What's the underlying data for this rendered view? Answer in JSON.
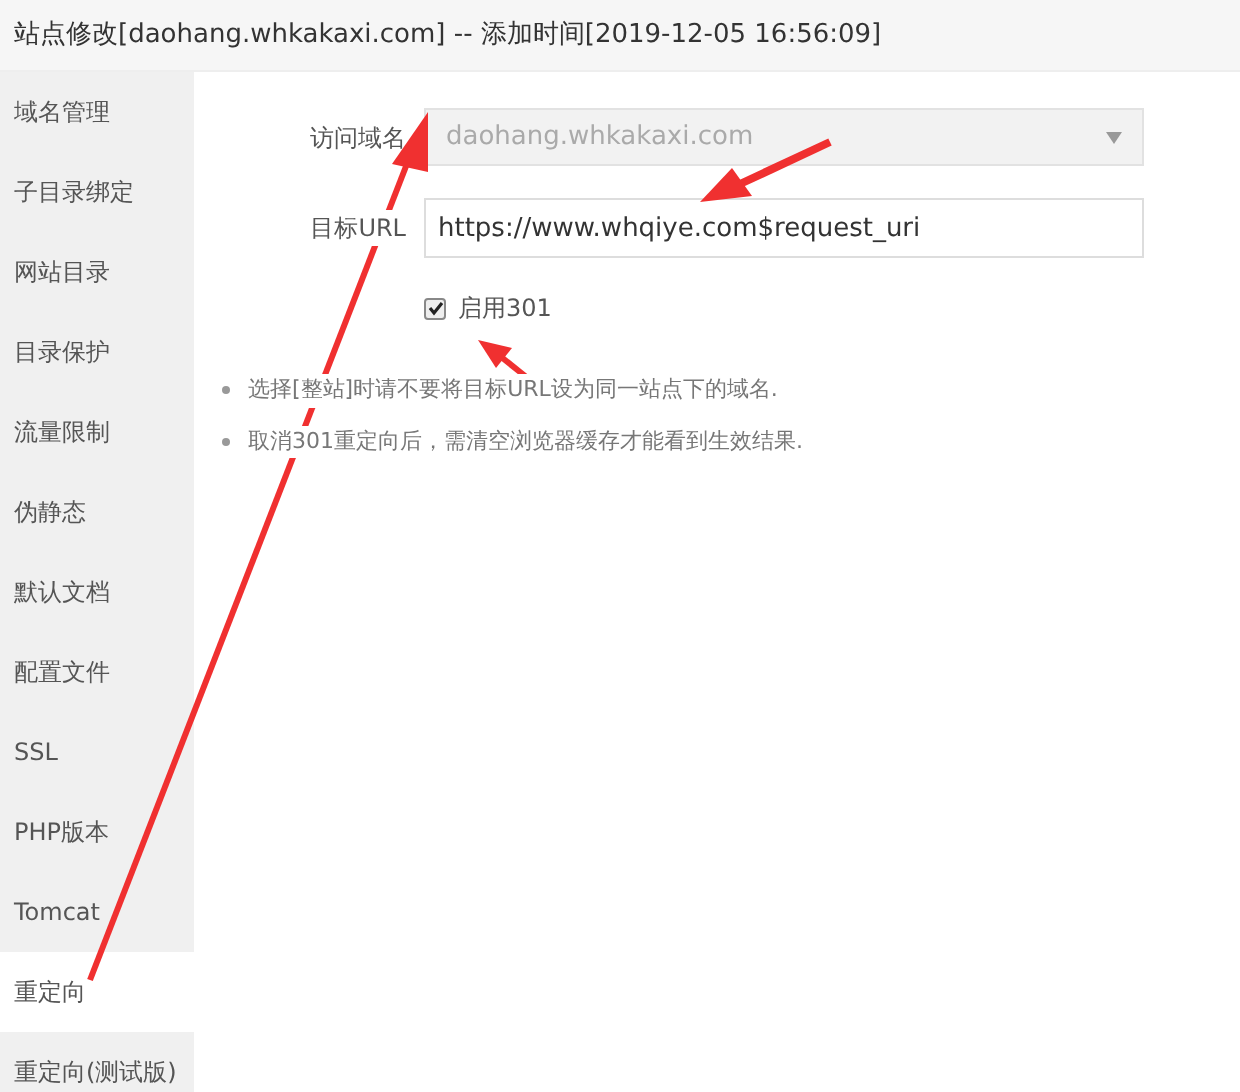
{
  "window": {
    "title": "站点修改[daohang.whkakaxi.com] -- 添加时间[2019-12-05 16:56:09]"
  },
  "sidebar": {
    "items": [
      {
        "label": "域名管理",
        "selected": false
      },
      {
        "label": "子目录绑定",
        "selected": false
      },
      {
        "label": "网站目录",
        "selected": false
      },
      {
        "label": "目录保护",
        "selected": false
      },
      {
        "label": "流量限制",
        "selected": false
      },
      {
        "label": "伪静态",
        "selected": false
      },
      {
        "label": "默认文档",
        "selected": false
      },
      {
        "label": "配置文件",
        "selected": false
      },
      {
        "label": "SSL",
        "selected": false
      },
      {
        "label": "PHP版本",
        "selected": false
      },
      {
        "label": "Tomcat",
        "selected": false
      },
      {
        "label": "重定向",
        "selected": true
      },
      {
        "label": "重定向(测试版)",
        "selected": false
      }
    ]
  },
  "form": {
    "domain": {
      "label": "访问域名",
      "value": "daohang.whkakaxi.com",
      "disabled": true
    },
    "target_url": {
      "label": "目标URL",
      "value": "https://www.whqiye.com$request_uri"
    },
    "enable_301": {
      "label": "启用301",
      "checked": true
    }
  },
  "notes": [
    "选择[整站]时请不要将目标URL设为同一站点下的域名.",
    "取消301重定向后，需清空浏览器缓存才能看到生效结果."
  ]
}
